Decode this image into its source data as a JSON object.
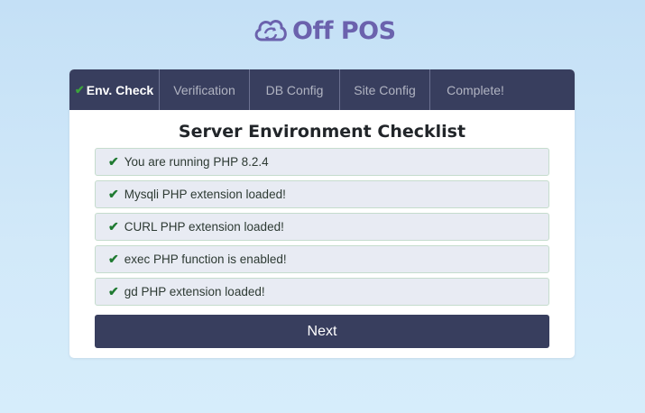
{
  "logo": {
    "text": "Off POS"
  },
  "tabs": [
    {
      "label": "Env. Check",
      "active": true
    },
    {
      "label": "Verification",
      "active": false
    },
    {
      "label": "DB Config",
      "active": false
    },
    {
      "label": "Site Config",
      "active": false
    },
    {
      "label": "Complete!",
      "active": false
    }
  ],
  "title": "Server Environment Checklist",
  "checks": [
    "You are running PHP 8.2.4",
    "Mysqli PHP extension loaded!",
    "CURL PHP extension loaded!",
    "exec PHP function is enabled!",
    "gd PHP extension loaded!"
  ],
  "next_label": "Next",
  "colors": {
    "brand": "#6b62ad",
    "nav": "#383e5e",
    "check": "#1f7a31"
  },
  "icons": {
    "logo": "cloud-sync-icon",
    "check": "checkmark-icon"
  }
}
